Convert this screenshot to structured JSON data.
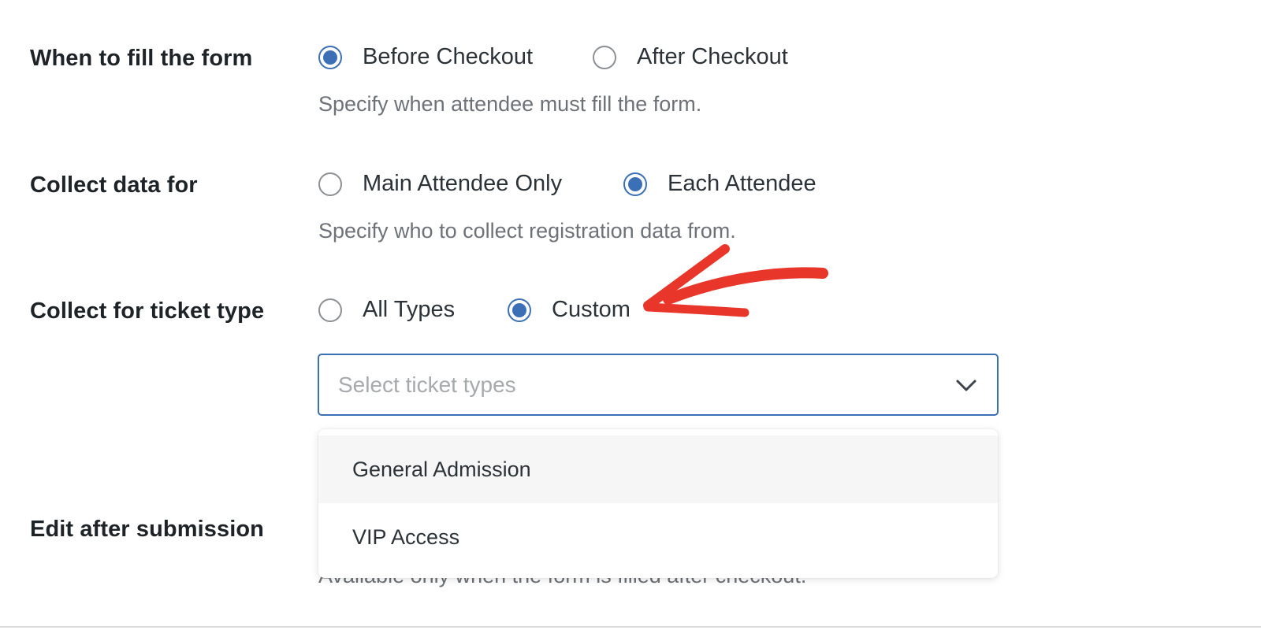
{
  "form": {
    "when_to_fill": {
      "label": "When to fill the form",
      "options": [
        "Before Checkout",
        "After Checkout"
      ],
      "selected": "Before Checkout",
      "help": "Specify when attendee must fill the form."
    },
    "collect_data_for": {
      "label": "Collect data for",
      "options": [
        "Main Attendee Only",
        "Each Attendee"
      ],
      "selected": "Each Attendee",
      "help": "Specify who to collect registration data from."
    },
    "ticket_type": {
      "label": "Collect for ticket type",
      "options": [
        "All Types",
        "Custom"
      ],
      "selected": "Custom",
      "select_placeholder": "Select ticket types",
      "dropdown_options": [
        "General Admission",
        "VIP Access"
      ]
    },
    "edit_after_submission": {
      "label": "Edit after submission",
      "help": "Available only when the form is filled after checkout."
    }
  },
  "colors": {
    "accent": "#3b6fb6",
    "annotation_arrow": "#e8362b"
  },
  "icons": {
    "select_toggle": "chevron-down-icon",
    "annotation": "red-arrow-annotation"
  }
}
